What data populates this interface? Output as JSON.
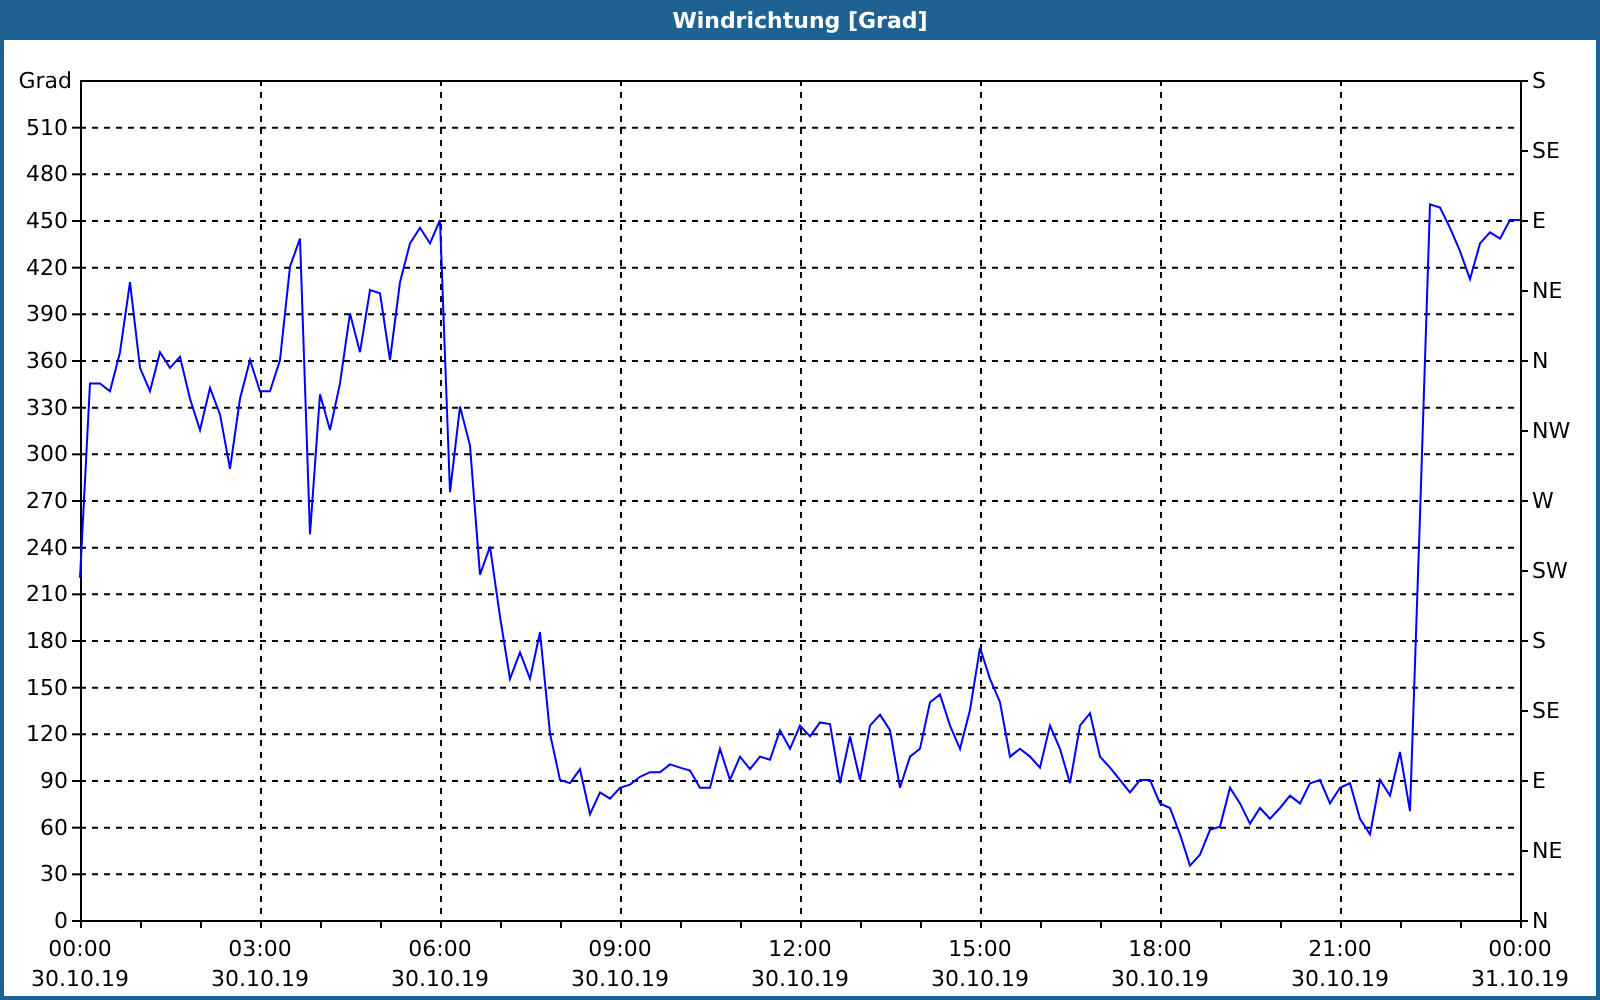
{
  "window": {
    "title": "Windrichtung [Grad]"
  },
  "chart": {
    "chart_data": {
      "type": "line",
      "grid": true,
      "ylabel": "Grad",
      "ylim": [
        0,
        540
      ],
      "categories": [
        "00:00 30.10.19",
        null,
        null,
        null,
        null,
        null,
        null,
        null,
        null,
        null,
        null,
        null,
        null,
        null,
        null,
        null,
        null,
        null,
        "03:00 30.10.19",
        null,
        null,
        null,
        null,
        null,
        null,
        null,
        null,
        null,
        null,
        null,
        null,
        null,
        null,
        null,
        null,
        null,
        "06:00 30.10.19",
        null,
        null,
        null,
        null,
        null,
        null,
        null,
        null,
        null,
        null,
        null,
        null,
        null,
        null,
        null,
        null,
        null,
        "09:00 30.10.19",
        null,
        null,
        null,
        null,
        null,
        null,
        null,
        null,
        null,
        null,
        null,
        null,
        null,
        null,
        null,
        null,
        null,
        "12:00 30.10.19",
        null,
        null,
        null,
        null,
        null,
        null,
        null,
        null,
        null,
        null,
        null,
        null,
        null,
        null,
        null,
        null,
        null,
        "15:00 30.10.19",
        null,
        null,
        null,
        null,
        null,
        null,
        null,
        null,
        null,
        null,
        null,
        null,
        null,
        null,
        null,
        null,
        null,
        "18:00 30.10.19",
        null,
        null,
        null,
        null,
        null,
        null,
        null,
        null,
        null,
        null,
        null,
        null,
        null,
        null,
        null,
        null,
        null,
        "21:00 30.10.19",
        null,
        null,
        null,
        null,
        null,
        null,
        null,
        null,
        null,
        null,
        null,
        null,
        null,
        null,
        null,
        null,
        null,
        "00:00 31.10.19"
      ],
      "series": [
        {
          "color": "#0000ff",
          "values": [
            220,
            345,
            345,
            340,
            365,
            410,
            355,
            340,
            365,
            355,
            362,
            335,
            315,
            342,
            325,
            290,
            335,
            360,
            340,
            340,
            360,
            420,
            438,
            248,
            338,
            315,
            345,
            390,
            365,
            405,
            403,
            360,
            410,
            435,
            445,
            435,
            450,
            275,
            330,
            305,
            222,
            240,
            195,
            155,
            172,
            155,
            185,
            120,
            90,
            88,
            97,
            68,
            82,
            78,
            85,
            87,
            92,
            95,
            95,
            100,
            98,
            96,
            85,
            85,
            110,
            90,
            105,
            97,
            105,
            103,
            122,
            110,
            125,
            118,
            127,
            126,
            88,
            118,
            90,
            125,
            132,
            122,
            85,
            105,
            110,
            140,
            145,
            125,
            110,
            135,
            175,
            155,
            140,
            105,
            110,
            105,
            98,
            125,
            110,
            88,
            125,
            133,
            105,
            98,
            90,
            82,
            90,
            90,
            75,
            72,
            55,
            35,
            42,
            58,
            60,
            85,
            75,
            62,
            72,
            65,
            72,
            80,
            75,
            88,
            90,
            75,
            85,
            88,
            65,
            55,
            90,
            80,
            108,
            70,
            260,
            460,
            458,
            445,
            430,
            412,
            435,
            442,
            438,
            450,
            450
          ]
        }
      ],
      "yticks": [
        0,
        30,
        60,
        90,
        120,
        150,
        180,
        210,
        240,
        270,
        300,
        330,
        360,
        390,
        420,
        450,
        480,
        510
      ]
    },
    "compass_labels": [
      "S",
      "SE",
      "E",
      "NE",
      "N",
      "NW",
      "W",
      "SW",
      "S",
      "SE",
      "E",
      "NE",
      "N"
    ]
  }
}
